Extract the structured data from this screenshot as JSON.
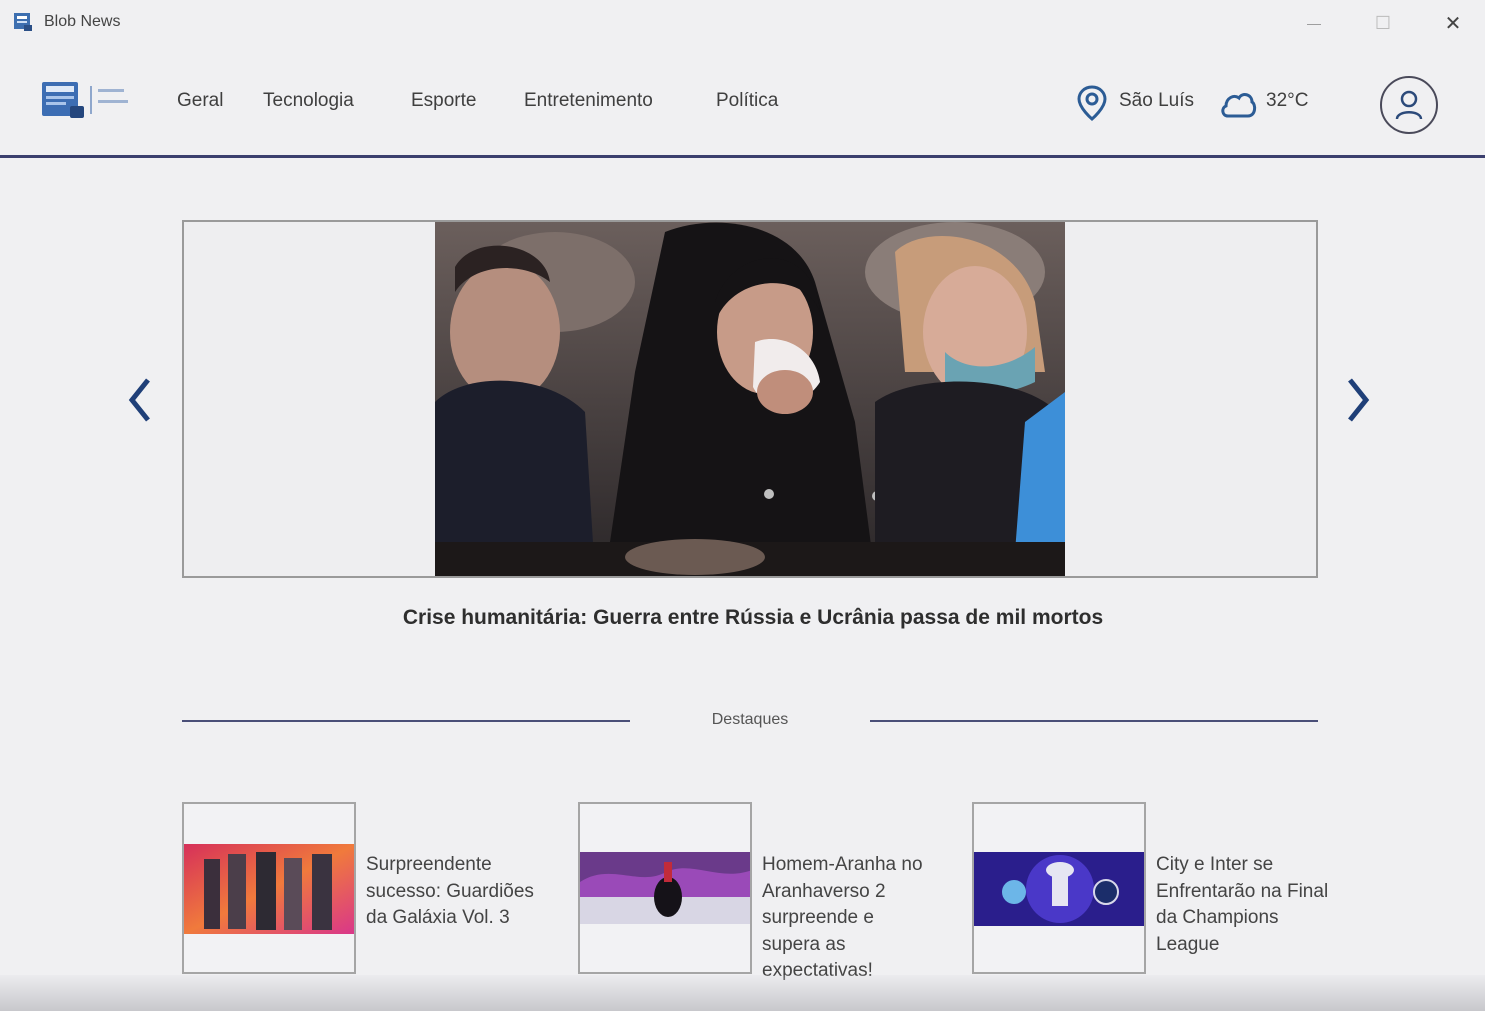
{
  "window": {
    "title": "Blob News",
    "minimize": "—",
    "maximize": "☐",
    "close": "✕"
  },
  "nav": {
    "items": [
      "Geral",
      "Tecnologia",
      "Esporte",
      "Entretenimento",
      "Política"
    ]
  },
  "location": {
    "city": "São Luís",
    "temperature": "32°C"
  },
  "carousel": {
    "headline": "Crise humanitária: Guerra entre Rússia e Ucrânia passa de mil mortos"
  },
  "highlights": {
    "label": "Destaques",
    "cards": [
      {
        "title": "Surpreendente sucesso: Guardiões da Galáxia Vol. 3"
      },
      {
        "title": "Homem-Aranha no Aranhaverso 2 surpreende e supera as expectativas!"
      },
      {
        "title": "City e Inter se Enfrentarão na Final da Champions League"
      }
    ]
  },
  "colors": {
    "accent": "#3b3f6e",
    "arrow": "#1f3f78",
    "background": "#f0f0f2"
  }
}
